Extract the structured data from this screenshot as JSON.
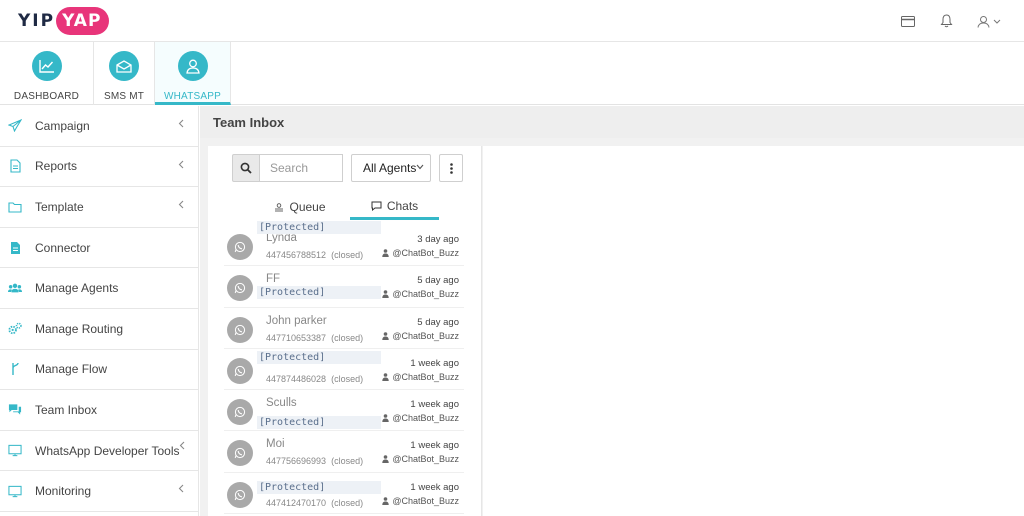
{
  "brand": {
    "part1": "YIP",
    "part2": "YAP"
  },
  "topbar": {
    "icons": [
      "card-icon",
      "bell-icon",
      "user-icon",
      "chevron-down-icon"
    ]
  },
  "tabs": [
    {
      "label": "DASHBOARD",
      "icon": "chart-line-icon"
    },
    {
      "label": "SMS MT",
      "icon": "envelope-icon"
    },
    {
      "label": "WHATSAPP",
      "icon": "user-icon"
    }
  ],
  "sidebar": {
    "items": [
      {
        "label": "Campaign",
        "icon": "paper-plane-icon",
        "chevron": true
      },
      {
        "label": "Reports",
        "icon": "file-icon",
        "chevron": true
      },
      {
        "label": "Template",
        "icon": "folder-icon",
        "chevron": true
      },
      {
        "label": "Connector",
        "icon": "document-icon",
        "chevron": false
      },
      {
        "label": "Manage Agents",
        "icon": "users-icon",
        "chevron": false
      },
      {
        "label": "Manage Routing",
        "icon": "gears-icon",
        "chevron": false
      },
      {
        "label": "Manage Flow",
        "icon": "flow-icon",
        "chevron": false
      },
      {
        "label": "Team Inbox",
        "icon": "comments-icon",
        "chevron": false
      },
      {
        "label": "WhatsApp Developer Tools",
        "icon": "monitor-icon",
        "chevron": true
      },
      {
        "label": "Monitoring",
        "icon": "monitor-icon",
        "chevron": true
      }
    ]
  },
  "page": {
    "title": "Team Inbox"
  },
  "inbox": {
    "search_placeholder": "Search",
    "agent_filter": "All Agents",
    "subtabs": {
      "queue": "Queue",
      "chats": "Chats"
    },
    "protected_label": "[Protected]",
    "chats": [
      {
        "name": "Lynda",
        "phone": "447456788512",
        "status": "(closed)",
        "time": "3 day ago",
        "bot": "@ChatBot_Buzz"
      },
      {
        "name": "FF",
        "phone": "",
        "status": "",
        "time": "5 day ago",
        "bot": "@ChatBot_Buzz"
      },
      {
        "name": "John parker",
        "phone": "447710653387",
        "status": "(closed)",
        "time": "5 day ago",
        "bot": "@ChatBot_Buzz"
      },
      {
        "name": "",
        "phone": "447874486028",
        "status": "(closed)",
        "time": "1 week ago",
        "bot": "@ChatBot_Buzz"
      },
      {
        "name": "Sculls",
        "phone": "",
        "status": "",
        "time": "1 week ago",
        "bot": "@ChatBot_Buzz"
      },
      {
        "name": "Moi",
        "phone": "447756696993",
        "status": "(closed)",
        "time": "1 week ago",
        "bot": "@ChatBot_Buzz"
      },
      {
        "name": "",
        "phone": "447412470170",
        "status": "(closed)",
        "time": "1 week ago",
        "bot": "@ChatBot_Buzz"
      }
    ]
  },
  "colors": {
    "accent": "#35b8c8",
    "brand_pink": "#e8357a",
    "avatar_grey": "#a9a9a9"
  }
}
